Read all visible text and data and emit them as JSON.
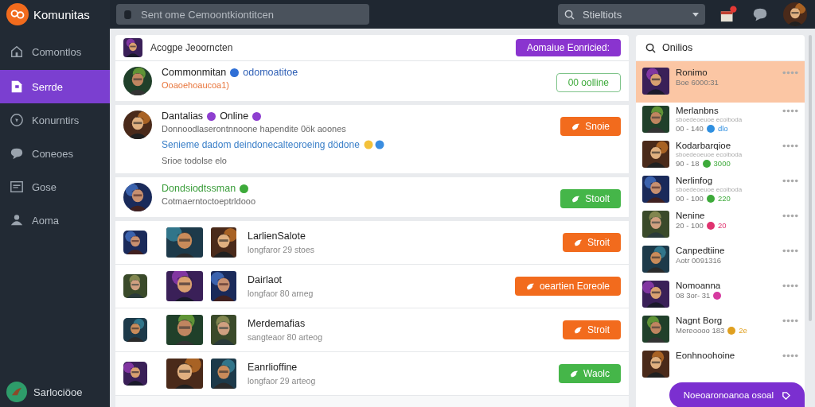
{
  "app": {
    "name": "Komunitas"
  },
  "topbar": {
    "search_placeholder": "Sent ome Cemoontkiontitcen",
    "filter_placeholder": "Stieltiots"
  },
  "sidebar": {
    "items": [
      {
        "label": "Comontlos",
        "selected": false
      },
      {
        "label": "Serrde",
        "selected": true
      },
      {
        "label": "Konurntirs",
        "selected": false
      },
      {
        "label": "Coneoes",
        "selected": false
      },
      {
        "label": "Gose",
        "selected": false
      },
      {
        "label": "Aoma",
        "selected": false
      }
    ],
    "footer": "Sarlociöoe"
  },
  "feed": {
    "header": {
      "title": "Acogpe Jeoorncten",
      "button": "Aomaiue Eonricied:"
    },
    "posts": [
      {
        "kind": "compact",
        "author": {
          "text": "Commonmitan",
          "color": "#222222"
        },
        "badge": {
          "color": "#2f6fd6"
        },
        "tag": "odomoatitoe",
        "lines": [
          {
            "text": "Ooaoehoaucoa1)",
            "color": "#e8743a"
          }
        ],
        "button": {
          "label": "00 oolline",
          "kind": "outline"
        }
      },
      {
        "kind": "large",
        "author": {
          "text": "Dantalias",
          "color": "#222222"
        },
        "badge": {
          "color": "#8e3fd0"
        },
        "tag": "Online",
        "tag_badge": {
          "color": "#8e3fd0"
        },
        "lines": [
          {
            "text": "Donnoodlaserontnnoone hapendite 0ök aoones",
            "color": "#666666"
          },
          {
            "text": "Senieme dadom deindonecalteoroeing dödone",
            "color": "#3a7fc8",
            "kind": "link"
          },
          {
            "text": "Srioe todolse elo",
            "color": "#666666"
          }
        ],
        "button": {
          "label": "Snoie",
          "kind": "orange"
        }
      },
      {
        "kind": "compact",
        "author": {
          "text": "Dondsiodtssman",
          "color": "#3a9d3a"
        },
        "badge": {
          "color": "#3daa3a"
        },
        "lines": [
          {
            "text": "Cotmaerntoctoeptrldooo",
            "color": "#666666"
          }
        ],
        "button": {
          "label": "Stoolt",
          "kind": "green"
        }
      }
    ],
    "entries": [
      {
        "title": "LarlienSalote",
        "meta": "longfaror 29 stoes",
        "button": {
          "label": "Stroit",
          "kind": "orange"
        }
      },
      {
        "title": "Dairlaot",
        "meta": "longfaor 80 arneg",
        "button": {
          "label": "oeartien Eoreole",
          "kind": "orange"
        }
      },
      {
        "title": "Merdemafias",
        "meta": "sangteaor 80 arteog",
        "button": {
          "label": "Stroit",
          "kind": "orange"
        }
      },
      {
        "title": "Eanrlioffine",
        "meta": "longfaor 29 arteog",
        "button": {
          "label": "Waolc",
          "kind": "green"
        }
      }
    ]
  },
  "online": {
    "search": "Onilios",
    "friends": [
      {
        "name": "Ronimo",
        "meta": "Boe 6000:31",
        "selected": true
      },
      {
        "name": "Merlanbns",
        "sub": "sboedeoeuoe ecolboda",
        "meta": "00 - 140",
        "tag": {
          "text": "dlo",
          "color": "#2f8fe0"
        },
        "selected": false
      },
      {
        "name": "Kodarbarqioe",
        "sub": "sboedeoeuoe ecolboda",
        "meta": "90 - 18",
        "tag": {
          "text": "3000",
          "color": "#3daa3a"
        },
        "selected": false
      },
      {
        "name": "Nerlinfog",
        "sub": "sboedeoeuoe ecolboda",
        "meta": "00 - 100",
        "tag": {
          "text": "220",
          "color": "#3daa3a"
        },
        "selected": false
      },
      {
        "name": "Nenine",
        "meta": "20 - 100",
        "tag": {
          "text": "20",
          "color": "#e0336f"
        },
        "selected": false
      },
      {
        "name": "Canpedtiine",
        "meta": "Aotr 0091316",
        "selected": false
      },
      {
        "name": "Nomoanna",
        "meta": "08 3or- 31",
        "tag": {
          "color": "#d63aa0"
        },
        "selected": false
      },
      {
        "name": "Nagnt Borg",
        "meta": "Mereoooo 183",
        "tag": {
          "text": "2e",
          "color": "#e0a020"
        },
        "selected": false
      },
      {
        "name": "Eonhnoohoine",
        "selected": false
      }
    ],
    "action": "Noeoaronoanoa osoal"
  }
}
